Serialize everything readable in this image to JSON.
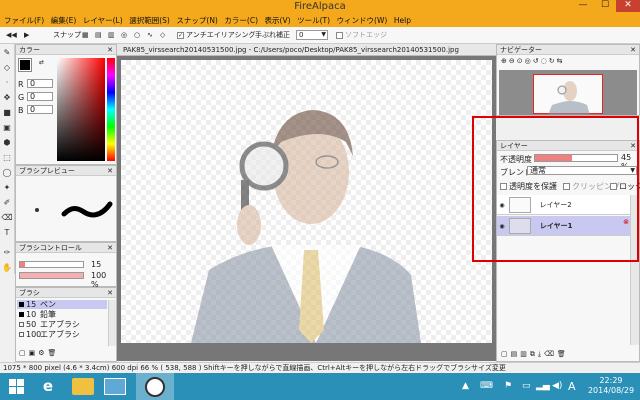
{
  "app": {
    "title": "FireAlpaca"
  },
  "window_controls": {
    "min": "—",
    "max": "☐",
    "close": "✕"
  },
  "menu": [
    "ファイル(F)",
    "編集(E)",
    "レイヤー(L)",
    "選択範囲(S)",
    "スナップ(N)",
    "カラー(C)",
    "表示(V)",
    "ツール(T)",
    "ウィンドウ(W)",
    "Help"
  ],
  "toolbar": {
    "snap": "スナップ",
    "antialias": "アンチエイリアシング",
    "stabilizer": "手ぶれ補正",
    "stabilizer_value": "0",
    "soft_edge": "ソフトエッジ"
  },
  "color_panel": {
    "title": "カラー",
    "r_label": "R",
    "g_label": "G",
    "b_label": "B",
    "r": "0",
    "g": "0",
    "b": "0"
  },
  "brush_preview": {
    "title": "ブラシプレビュー"
  },
  "brush_control": {
    "title": "ブラシコントロール",
    "size": "15",
    "opacity": "100 %"
  },
  "brush_list": {
    "title": "ブラシ",
    "items": [
      {
        "size": "15",
        "name": "ペン"
      },
      {
        "size": "10",
        "name": "鉛筆"
      },
      {
        "size": "50",
        "name": "エアブラシ"
      },
      {
        "size": "100",
        "name": "エアブラシ"
      }
    ]
  },
  "document": {
    "tab": "PAK85_virssearch20140531500.jpg - C:/Users/poco/Desktop/PAK85_virssearch20140531500.jpg"
  },
  "navigator": {
    "title": "ナビゲーター"
  },
  "layers": {
    "title": "レイヤー",
    "opacity_label": "不透明度",
    "opacity": "45 %",
    "opacity_frac": 0.45,
    "blend_label": "ブレンド",
    "blend": "通常",
    "protect": "透明度を保護",
    "clipping": "クリッピング",
    "lock": "ロック",
    "items": [
      {
        "name": "レイヤー2",
        "selected": false
      },
      {
        "name": "レイヤー1",
        "selected": true
      }
    ]
  },
  "status": "1075 * 800 pixel  (4.6 * 3.4cm)  600 dpi   66 %   ( 538, 588 )   Shiftキーを押しながらで直線描画、Ctrl+Altキーを押しながら左右ドラッグでブラシサイズ変更",
  "taskbar": {
    "ime": "A",
    "time": "22:29",
    "date": "2014/08/29"
  }
}
